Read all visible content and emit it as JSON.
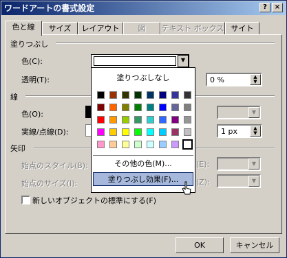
{
  "window": {
    "title": "ワードアートの書式設定",
    "help_btn": "?",
    "close_btn": "×"
  },
  "tabs": [
    {
      "label": "色と線",
      "state": "active"
    },
    {
      "label": "サイズ",
      "state": "normal"
    },
    {
      "label": "レイアウト",
      "state": "normal"
    },
    {
      "label": "図",
      "state": "disabled"
    },
    {
      "label": "テキスト ボックス",
      "state": "disabled"
    },
    {
      "label": "サイト",
      "state": "normal"
    }
  ],
  "fill": {
    "group": "塗りつぶし",
    "color_label": "色(C):",
    "transparency_label": "透明(T):",
    "transparency_value": "0 %"
  },
  "line": {
    "group": "線",
    "color_label": "色(O):",
    "style_label": "実線/点線(D):",
    "weight_value": "1 px"
  },
  "arrows": {
    "group": "矢印",
    "begin_style": "始点のスタイル(B):",
    "begin_size": "始点のサイズ(I):",
    "end_style": "(E):",
    "end_size": "(Z):"
  },
  "default_checkbox": "新しいオブジェクトの標準にする(F)",
  "buttons": {
    "ok": "OK",
    "cancel": "キャンセル"
  },
  "popup": {
    "no_fill": "塗りつぶしなし",
    "more_colors": "その他の色(M)...",
    "fill_effects": "塗りつぶし効果(F)...",
    "colors": [
      [
        "#000000",
        "#993300",
        "#333300",
        "#003300",
        "#003366",
        "#000080",
        "#333399",
        "#333333"
      ],
      [
        "#800000",
        "#FF6600",
        "#808000",
        "#008000",
        "#008080",
        "#0000FF",
        "#666699",
        "#808080"
      ],
      [
        "#FF0000",
        "#FF9900",
        "#99CC00",
        "#339966",
        "#33CCCC",
        "#3366FF",
        "#800080",
        "#969696"
      ],
      [
        "#FF00FF",
        "#FFCC00",
        "#FFFF00",
        "#00FF00",
        "#00FFFF",
        "#00CCFF",
        "#993366",
        "#C0C0C0"
      ],
      [
        "#FF99CC",
        "#FFCC99",
        "#FFFF99",
        "#CCFFCC",
        "#CCFFFF",
        "#99CCFF",
        "#CC99FF",
        "#FFFFFF"
      ]
    ]
  }
}
